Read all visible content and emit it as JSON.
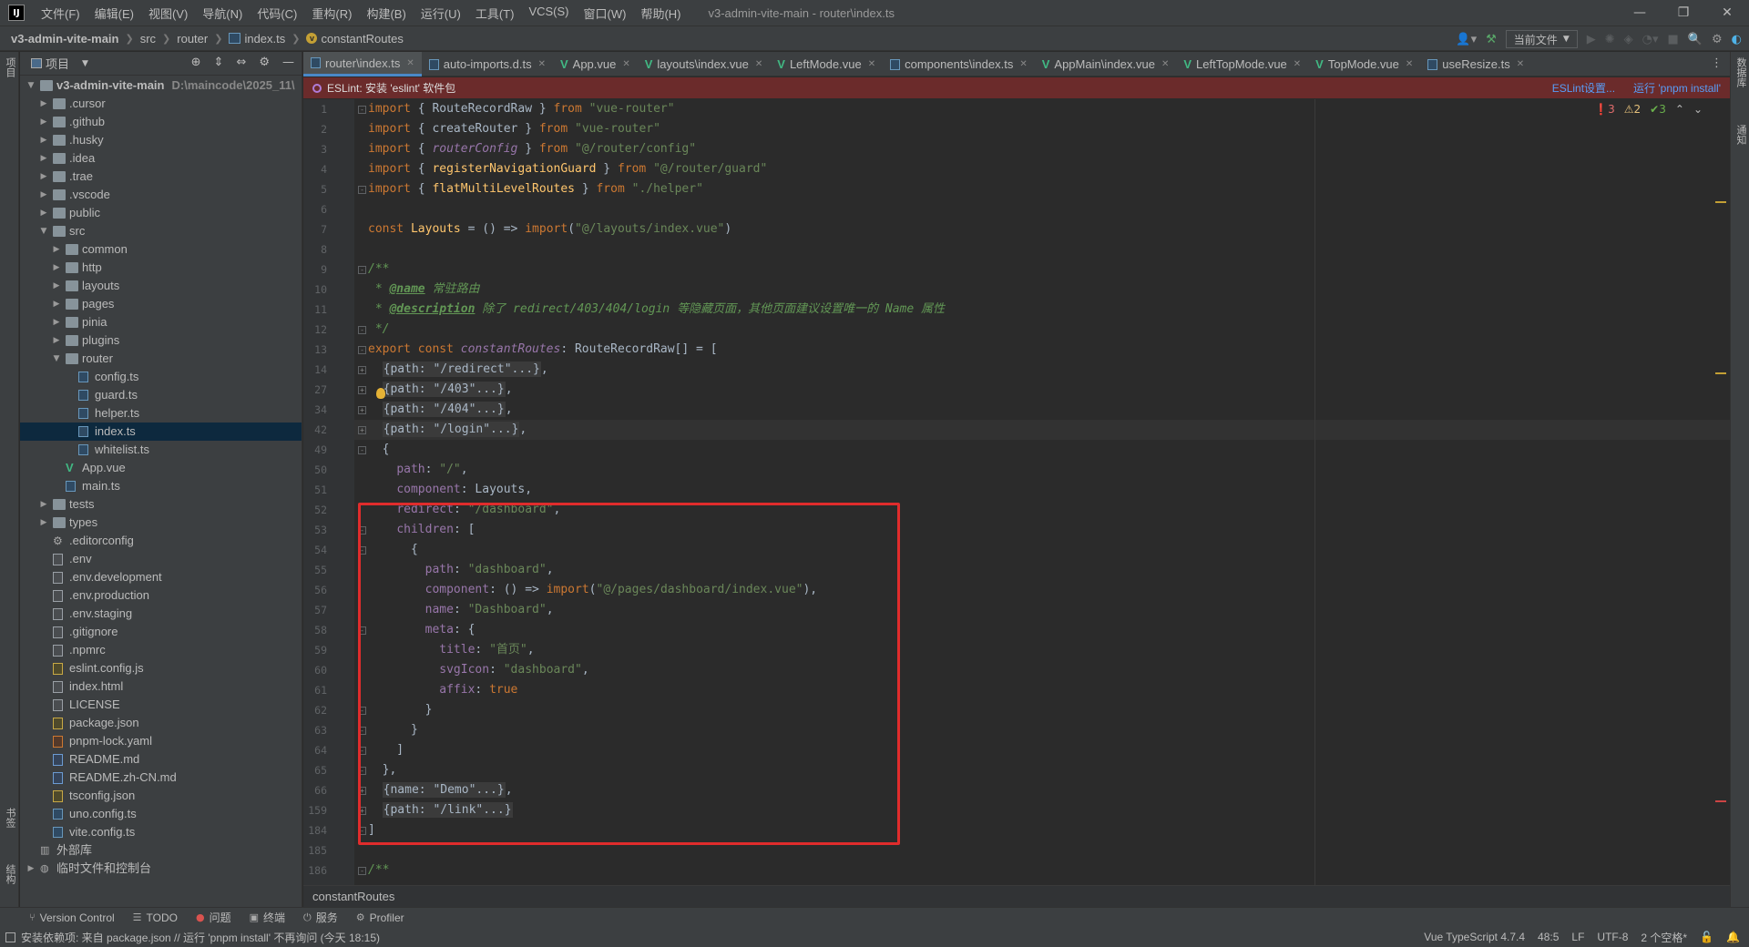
{
  "app": {
    "logo": "IJ",
    "menu": [
      "文件(F)",
      "编辑(E)",
      "视图(V)",
      "导航(N)",
      "代码(C)",
      "重构(R)",
      "构建(B)",
      "运行(U)",
      "工具(T)",
      "VCS(S)",
      "窗口(W)",
      "帮助(H)"
    ],
    "window_title": "v3-admin-vite-main - router\\index.ts",
    "win_controls": [
      "—",
      "❐",
      "✕"
    ]
  },
  "navbar": {
    "crumbs": [
      "v3-admin-vite-main",
      "src",
      "router",
      "index.ts",
      "constantRoutes"
    ],
    "run_config": "当前文件"
  },
  "left_stripe": [
    "项目",
    "书签",
    "结构"
  ],
  "right_stripe": [
    "数据库",
    "通知"
  ],
  "project_panel": {
    "title": "项目",
    "tree": [
      {
        "label": "v3-admin-vite-main",
        "hint": "D:\\maincode\\2025_11\\",
        "level": 0,
        "arrow": "open",
        "type": "project",
        "bold": true
      },
      {
        "label": ".cursor",
        "level": 1,
        "arrow": "closed",
        "type": "folder"
      },
      {
        "label": ".github",
        "level": 1,
        "arrow": "closed",
        "type": "folder"
      },
      {
        "label": ".husky",
        "level": 1,
        "arrow": "closed",
        "type": "folder"
      },
      {
        "label": ".idea",
        "level": 1,
        "arrow": "closed",
        "type": "folder"
      },
      {
        "label": ".trae",
        "level": 1,
        "arrow": "closed",
        "type": "folder"
      },
      {
        "label": ".vscode",
        "level": 1,
        "arrow": "closed",
        "type": "folder"
      },
      {
        "label": "public",
        "level": 1,
        "arrow": "closed",
        "type": "folder"
      },
      {
        "label": "src",
        "level": 1,
        "arrow": "open",
        "type": "folder"
      },
      {
        "label": "common",
        "level": 2,
        "arrow": "closed",
        "type": "folder"
      },
      {
        "label": "http",
        "level": 2,
        "arrow": "closed",
        "type": "folder"
      },
      {
        "label": "layouts",
        "level": 2,
        "arrow": "closed",
        "type": "folder"
      },
      {
        "label": "pages",
        "level": 2,
        "arrow": "closed",
        "type": "folder"
      },
      {
        "label": "pinia",
        "level": 2,
        "arrow": "closed",
        "type": "folder"
      },
      {
        "label": "plugins",
        "level": 2,
        "arrow": "closed",
        "type": "folder"
      },
      {
        "label": "router",
        "level": 2,
        "arrow": "open",
        "type": "folder"
      },
      {
        "label": "config.ts",
        "level": 3,
        "arrow": "none",
        "type": "ts"
      },
      {
        "label": "guard.ts",
        "level": 3,
        "arrow": "none",
        "type": "ts"
      },
      {
        "label": "helper.ts",
        "level": 3,
        "arrow": "none",
        "type": "ts"
      },
      {
        "label": "index.ts",
        "level": 3,
        "arrow": "none",
        "type": "ts",
        "selected": true
      },
      {
        "label": "whitelist.ts",
        "level": 3,
        "arrow": "none",
        "type": "ts"
      },
      {
        "label": "App.vue",
        "level": 2,
        "arrow": "none",
        "type": "vue"
      },
      {
        "label": "main.ts",
        "level": 2,
        "arrow": "none",
        "type": "ts"
      },
      {
        "label": "tests",
        "level": 1,
        "arrow": "closed",
        "type": "folder"
      },
      {
        "label": "types",
        "level": 1,
        "arrow": "closed",
        "type": "folder"
      },
      {
        "label": ".editorconfig",
        "level": 1,
        "arrow": "none",
        "type": "gear"
      },
      {
        "label": ".env",
        "level": 1,
        "arrow": "none",
        "type": "gen"
      },
      {
        "label": ".env.development",
        "level": 1,
        "arrow": "none",
        "type": "gen"
      },
      {
        "label": ".env.production",
        "level": 1,
        "arrow": "none",
        "type": "gen"
      },
      {
        "label": ".env.staging",
        "level": 1,
        "arrow": "none",
        "type": "gen"
      },
      {
        "label": ".gitignore",
        "level": 1,
        "arrow": "none",
        "type": "gen"
      },
      {
        "label": ".npmrc",
        "level": 1,
        "arrow": "none",
        "type": "gen"
      },
      {
        "label": "eslint.config.js",
        "level": 1,
        "arrow": "none",
        "type": "json"
      },
      {
        "label": "index.html",
        "level": 1,
        "arrow": "none",
        "type": "gen"
      },
      {
        "label": "LICENSE",
        "level": 1,
        "arrow": "none",
        "type": "gen"
      },
      {
        "label": "package.json",
        "level": 1,
        "arrow": "none",
        "type": "json"
      },
      {
        "label": "pnpm-lock.yaml",
        "level": 1,
        "arrow": "none",
        "type": "yaml"
      },
      {
        "label": "README.md",
        "level": 1,
        "arrow": "none",
        "type": "md"
      },
      {
        "label": "README.zh-CN.md",
        "level": 1,
        "arrow": "none",
        "type": "md"
      },
      {
        "label": "tsconfig.json",
        "level": 1,
        "arrow": "none",
        "type": "json"
      },
      {
        "label": "uno.config.ts",
        "level": 1,
        "arrow": "none",
        "type": "ts"
      },
      {
        "label": "vite.config.ts",
        "level": 1,
        "arrow": "none",
        "type": "ts"
      },
      {
        "label": "外部库",
        "level": 0,
        "arrow": "none",
        "type": "lib"
      },
      {
        "label": "临时文件和控制台",
        "level": 0,
        "arrow": "closed",
        "type": "lib"
      }
    ]
  },
  "tabs": [
    {
      "label": "router\\index.ts",
      "type": "ts",
      "active": true
    },
    {
      "label": "auto-imports.d.ts",
      "type": "ts"
    },
    {
      "label": "App.vue",
      "type": "vue"
    },
    {
      "label": "layouts\\index.vue",
      "type": "vue"
    },
    {
      "label": "LeftMode.vue",
      "type": "vue"
    },
    {
      "label": "components\\index.ts",
      "type": "ts"
    },
    {
      "label": "AppMain\\index.vue",
      "type": "vue"
    },
    {
      "label": "LeftTopMode.vue",
      "type": "vue"
    },
    {
      "label": "TopMode.vue",
      "type": "vue"
    },
    {
      "label": "useResize.ts",
      "type": "ts"
    }
  ],
  "eslint_banner": {
    "message": "ESLint: 安装 'eslint' 软件包",
    "link_settings": "ESLint设置...",
    "link_install": "运行 'pnpm install'"
  },
  "problems": {
    "errors": "3",
    "warnings": "2",
    "ok": "3"
  },
  "code": {
    "line_numbers": [
      "1",
      "2",
      "3",
      "4",
      "5",
      "6",
      "7",
      "8",
      "9",
      "10",
      "11",
      "12",
      "13",
      "14",
      "27",
      "34",
      "42",
      "49",
      "50",
      "51",
      "52",
      "53",
      "54",
      "55",
      "56",
      "57",
      "58",
      "59",
      "60",
      "61",
      "62",
      "63",
      "64",
      "65",
      "66",
      "159",
      "184",
      "185",
      "186"
    ],
    "lines": [
      [
        [
          "kw",
          "import"
        ],
        [
          "p",
          " { RouteRecordRaw } "
        ],
        [
          "kw",
          "from"
        ],
        [
          "str",
          " \"vue-router\""
        ]
      ],
      [
        [
          "kw",
          "import"
        ],
        [
          "p",
          " { createRouter } "
        ],
        [
          "kw",
          "from"
        ],
        [
          "str",
          " \"vue-router\""
        ]
      ],
      [
        [
          "kw",
          "import"
        ],
        [
          "p",
          " { "
        ],
        [
          "it",
          "routerConfig"
        ],
        [
          "p",
          " } "
        ],
        [
          "kw",
          "from"
        ],
        [
          "str",
          " \"@/router/config\""
        ]
      ],
      [
        [
          "kw",
          "import"
        ],
        [
          "p",
          " { "
        ],
        [
          "fn",
          "registerNavigationGuard"
        ],
        [
          "p",
          " } "
        ],
        [
          "kw",
          "from"
        ],
        [
          "str",
          " \"@/router/guard\""
        ]
      ],
      [
        [
          "kw",
          "import"
        ],
        [
          "p",
          " { "
        ],
        [
          "fn",
          "flatMultiLevelRoutes"
        ],
        [
          "p",
          " } "
        ],
        [
          "kw",
          "from"
        ],
        [
          "str",
          " \"./helper\""
        ]
      ],
      [
        [
          "p",
          ""
        ]
      ],
      [
        [
          "kw",
          "const"
        ],
        [
          "p",
          " "
        ],
        [
          "fn",
          "Layouts"
        ],
        [
          "p",
          " = () => "
        ],
        [
          "kw",
          "import"
        ],
        [
          "p",
          "("
        ],
        [
          "str",
          "\"@/layouts/index.vue\""
        ],
        [
          "p",
          ")"
        ]
      ],
      [
        [
          "p",
          ""
        ]
      ],
      [
        [
          "cmt",
          "/**"
        ]
      ],
      [
        [
          "cmt",
          " * "
        ],
        [
          "tag",
          "@name"
        ],
        [
          "cmt",
          " 常驻路由"
        ]
      ],
      [
        [
          "cmt",
          " * "
        ],
        [
          "tag",
          "@description"
        ],
        [
          "cmt",
          " 除了 redirect/403/404/login 等隐藏页面，其他页面建议设置唯一的 Name 属性"
        ]
      ],
      [
        [
          "cmt",
          " */"
        ]
      ],
      [
        [
          "kw",
          "export const"
        ],
        [
          "p",
          " "
        ],
        [
          "it",
          "constantRoutes"
        ],
        [
          "p",
          ": RouteRecordRaw[] = ["
        ]
      ],
      [
        [
          "p",
          "  "
        ],
        [
          "fd",
          "{path: \"/redirect\"...}"
        ],
        [
          "p",
          ","
        ]
      ],
      [
        [
          "p",
          "  "
        ],
        [
          "fd",
          "{path: \"/403\"...}"
        ],
        [
          "p",
          ","
        ]
      ],
      [
        [
          "p",
          "  "
        ],
        [
          "fd",
          "{path: \"/404\"...}"
        ],
        [
          "p",
          ","
        ]
      ],
      [
        [
          "p",
          "  "
        ],
        [
          "fd",
          "{path: \"/login\"...}"
        ],
        [
          "p",
          ","
        ]
      ],
      [
        [
          "p",
          "  {"
        ]
      ],
      [
        [
          "p",
          "    "
        ],
        [
          "prop",
          "path"
        ],
        [
          "p",
          ": "
        ],
        [
          "str",
          "\"/\""
        ],
        [
          "p",
          ","
        ]
      ],
      [
        [
          "p",
          "    "
        ],
        [
          "prop",
          "component"
        ],
        [
          "p",
          ": Layouts,"
        ]
      ],
      [
        [
          "p",
          "    "
        ],
        [
          "prop",
          "redirect"
        ],
        [
          "p",
          ": "
        ],
        [
          "str",
          "\"/dashboard\""
        ],
        [
          "p",
          ","
        ]
      ],
      [
        [
          "p",
          "    "
        ],
        [
          "prop",
          "children"
        ],
        [
          "p",
          ": ["
        ]
      ],
      [
        [
          "p",
          "      {"
        ]
      ],
      [
        [
          "p",
          "        "
        ],
        [
          "prop",
          "path"
        ],
        [
          "p",
          ": "
        ],
        [
          "str",
          "\"dashboard\""
        ],
        [
          "p",
          ","
        ]
      ],
      [
        [
          "p",
          "        "
        ],
        [
          "prop",
          "component"
        ],
        [
          "p",
          ": () => "
        ],
        [
          "kw",
          "import"
        ],
        [
          "p",
          "("
        ],
        [
          "str",
          "\"@/pages/dashboard/index.vue\""
        ],
        [
          "p",
          "),"
        ]
      ],
      [
        [
          "p",
          "        "
        ],
        [
          "prop",
          "name"
        ],
        [
          "p",
          ": "
        ],
        [
          "str",
          "\"Dashboard\""
        ],
        [
          "p",
          ","
        ]
      ],
      [
        [
          "p",
          "        "
        ],
        [
          "prop",
          "meta"
        ],
        [
          "p",
          ": {"
        ]
      ],
      [
        [
          "p",
          "          "
        ],
        [
          "prop",
          "title"
        ],
        [
          "p",
          ": "
        ],
        [
          "str",
          "\"首页\""
        ],
        [
          "p",
          ","
        ]
      ],
      [
        [
          "p",
          "          "
        ],
        [
          "prop",
          "svgIcon"
        ],
        [
          "p",
          ": "
        ],
        [
          "str",
          "\"dashboard\""
        ],
        [
          "p",
          ","
        ]
      ],
      [
        [
          "p",
          "          "
        ],
        [
          "prop",
          "affix"
        ],
        [
          "p",
          ": "
        ],
        [
          "kw",
          "true"
        ]
      ],
      [
        [
          "p",
          "        }"
        ]
      ],
      [
        [
          "p",
          "      }"
        ]
      ],
      [
        [
          "p",
          "    ]"
        ]
      ],
      [
        [
          "p",
          "  },"
        ]
      ],
      [
        [
          "p",
          "  "
        ],
        [
          "fd",
          "{name: \"Demo\"...}"
        ],
        [
          "p",
          ","
        ]
      ],
      [
        [
          "p",
          "  "
        ],
        [
          "fd",
          "{path: \"/link\"...}"
        ]
      ],
      [
        [
          "p",
          "]"
        ]
      ],
      [
        [
          "p",
          ""
        ]
      ],
      [
        [
          "cmt",
          "/**"
        ]
      ]
    ]
  },
  "breadcrumb_bottom": "constantRoutes",
  "tool_windows": [
    {
      "label": "Version Control",
      "icon": "⑂"
    },
    {
      "label": "TODO",
      "icon": "☰"
    },
    {
      "label": "问题",
      "icon": "●"
    },
    {
      "label": "终端",
      "icon": "▣"
    },
    {
      "label": "服务",
      "icon": "⏻"
    },
    {
      "label": "Profiler",
      "icon": "⚙"
    }
  ],
  "status": {
    "message": "安装依赖项: 来自 package.json // 运行 'pnpm install'   不再询问 (今天 18:15)",
    "language": "Vue TypeScript 4.7.4",
    "position": "48:5",
    "line_sep": "LF",
    "encoding": "UTF-8",
    "indent": "2 个空格*"
  }
}
